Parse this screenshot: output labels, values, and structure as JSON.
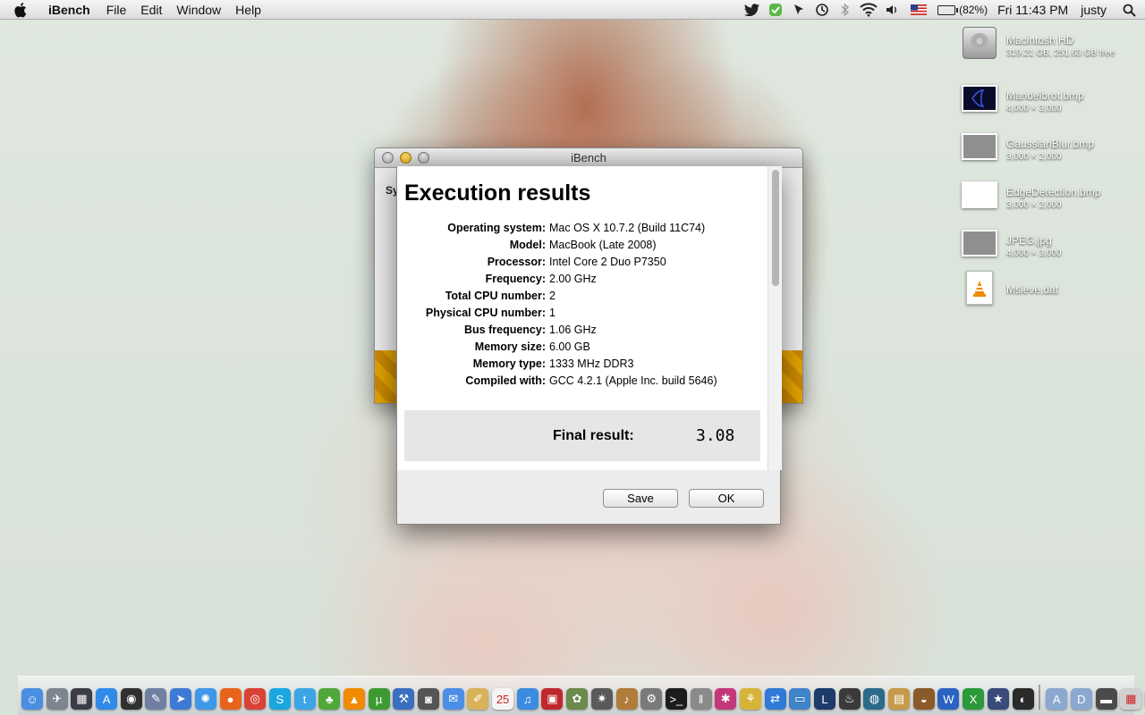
{
  "menubar": {
    "app_name": "iBench",
    "items": [
      "File",
      "Edit",
      "Window",
      "Help"
    ],
    "battery": "(82%)",
    "clock": "Fri 11:43 PM",
    "user": "justy"
  },
  "desktop_icons": [
    {
      "name": "Macintosh HD",
      "info": "319.21 GB, 251.63 GB free",
      "kind": "hard-drive-icon"
    },
    {
      "name": "Mandelbrot.bmp",
      "info": "4,000 × 3,000",
      "kind": "image-thumb",
      "color": "#0a0a2a"
    },
    {
      "name": "GaussianBlur.bmp",
      "info": "3,000 × 2,000",
      "kind": "image-thumb",
      "color": "#8f8f8f"
    },
    {
      "name": "EdgeDetection.bmp",
      "info": "3,000 × 2,000",
      "kind": "image-thumb",
      "color": "#ffffff"
    },
    {
      "name": "JPEG.jpg",
      "info": "4,000 × 3,000",
      "kind": "image-thumb",
      "color": "#8f8f8f"
    },
    {
      "name": "Msieve.dat",
      "info": "",
      "kind": "vlc-document-icon"
    }
  ],
  "back_window": {
    "title": "iBench",
    "label": "Sy"
  },
  "results": {
    "title": "Execution results",
    "rows": [
      {
        "key": "Operating system:",
        "value": "Mac OS X 10.7.2 (Build 11C74)"
      },
      {
        "key": "Model:",
        "value": "MacBook (Late 2008)"
      },
      {
        "key": "Processor:",
        "value": "Intel Core 2 Duo P7350"
      },
      {
        "key": "Frequency:",
        "value": "2.00 GHz"
      },
      {
        "key": "Total CPU number:",
        "value": "2"
      },
      {
        "key": "Physical CPU number:",
        "value": "1"
      },
      {
        "key": "Bus frequency:",
        "value": "1.06 GHz"
      },
      {
        "key": "Memory size:",
        "value": "6.00 GB"
      },
      {
        "key": "Memory type:",
        "value": "1333 MHz DDR3"
      },
      {
        "key": "Compiled with:",
        "value": "GCC 4.2.1 (Apple Inc. build 5646)"
      }
    ],
    "final_label": "Final result:",
    "final_value": "3.08",
    "save_label": "Save",
    "ok_label": "OK"
  },
  "dock": {
    "apps": [
      {
        "name": "finder-icon",
        "color": "#4a8fe0",
        "glyph": "☺"
      },
      {
        "name": "launchpad-icon",
        "color": "#7d8590",
        "glyph": "✈"
      },
      {
        "name": "mission-control-icon",
        "color": "#3c3c46",
        "glyph": "▦"
      },
      {
        "name": "app-store-icon",
        "color": "#2f8ae8",
        "glyph": "A"
      },
      {
        "name": "dashboard-icon",
        "color": "#303030",
        "glyph": "◉"
      },
      {
        "name": "preview-icon",
        "color": "#6e7fa0",
        "glyph": "✎"
      },
      {
        "name": "mail-icon",
        "color": "#3d7ad6",
        "glyph": "➤"
      },
      {
        "name": "safari-icon",
        "color": "#3e97e8",
        "glyph": "✺"
      },
      {
        "name": "firefox-icon",
        "color": "#e8641c",
        "glyph": "●"
      },
      {
        "name": "chrome-icon",
        "color": "#d94235",
        "glyph": "◎"
      },
      {
        "name": "skype-icon",
        "color": "#19a7e0",
        "glyph": "S"
      },
      {
        "name": "twitter-icon",
        "color": "#3ca5e6",
        "glyph": "t"
      },
      {
        "name": "adium-icon",
        "color": "#4fa83a",
        "glyph": "♣"
      },
      {
        "name": "vlc-icon",
        "color": "#f08a00",
        "glyph": "▲"
      },
      {
        "name": "utorrent-icon",
        "color": "#3d9a32",
        "glyph": "µ"
      },
      {
        "name": "xcode-icon",
        "color": "#3a6fc0",
        "glyph": "⚒"
      },
      {
        "name": "facetime-icon",
        "color": "#555",
        "glyph": "◙"
      },
      {
        "name": "messages-icon",
        "color": "#4c8ee6",
        "glyph": "✉"
      },
      {
        "name": "notes-icon",
        "color": "#d8b25a",
        "glyph": "✐"
      },
      {
        "name": "calendar-icon",
        "color": "#f4f4f4",
        "glyph": "25"
      },
      {
        "name": "itunes-icon",
        "color": "#3b8be0",
        "glyph": "♫"
      },
      {
        "name": "photo-booth-icon",
        "color": "#c0282d",
        "glyph": "▣"
      },
      {
        "name": "iphoto-icon",
        "color": "#6b8a4b",
        "glyph": "✿"
      },
      {
        "name": "aperture-icon",
        "color": "#5a5a5a",
        "glyph": "✷"
      },
      {
        "name": "garageband-icon",
        "color": "#b07c3a",
        "glyph": "♪"
      },
      {
        "name": "system-preferences-icon",
        "color": "#7a7a7a",
        "glyph": "⚙"
      },
      {
        "name": "terminal-icon",
        "color": "#1c1c1c",
        "glyph": ">_"
      },
      {
        "name": "parallels-icon",
        "color": "#8a8a8a",
        "glyph": "‖"
      },
      {
        "name": "cyberduck-icon",
        "color": "#c2387a",
        "glyph": "✱"
      },
      {
        "name": "transmit-icon",
        "color": "#d6b43a",
        "glyph": "⚘"
      },
      {
        "name": "teamviewer-icon",
        "color": "#2f7ad6",
        "glyph": "⇄"
      },
      {
        "name": "screen-sharing-icon",
        "color": "#3f83c9",
        "glyph": "▭"
      },
      {
        "name": "league-of-legends-icon",
        "color": "#1d3b6b",
        "glyph": "L"
      },
      {
        "name": "steam-icon",
        "color": "#3a3a3a",
        "glyph": "♨"
      },
      {
        "name": "earth-icon",
        "color": "#2b6b8a",
        "glyph": "◍"
      },
      {
        "name": "archive-utility-icon",
        "color": "#c79a4a",
        "glyph": "▤"
      },
      {
        "name": "coconut-battery-icon",
        "color": "#8a5a2a",
        "glyph": "◒"
      },
      {
        "name": "word-icon",
        "color": "#2b63c0",
        "glyph": "W"
      },
      {
        "name": "excel-icon",
        "color": "#2b9a3a",
        "glyph": "X"
      },
      {
        "name": "imovie-icon",
        "color": "#3a4a7a",
        "glyph": "★"
      },
      {
        "name": "activity-monitor-icon",
        "color": "#2a2a2a",
        "glyph": "◐"
      }
    ],
    "stacks": [
      {
        "name": "applications-folder-icon",
        "color": "#8aa8d0",
        "glyph": "A"
      },
      {
        "name": "documents-folder-icon",
        "color": "#8aa8d0",
        "glyph": "D"
      },
      {
        "name": "downloads-stack-icon",
        "color": "#4a4a4a",
        "glyph": "▬"
      },
      {
        "name": "desktop-stack-icon",
        "color": "#d0d0d0",
        "glyph": "▦"
      },
      {
        "name": "trash-icon",
        "color": "#8a8a8a",
        "glyph": "▥"
      }
    ]
  }
}
